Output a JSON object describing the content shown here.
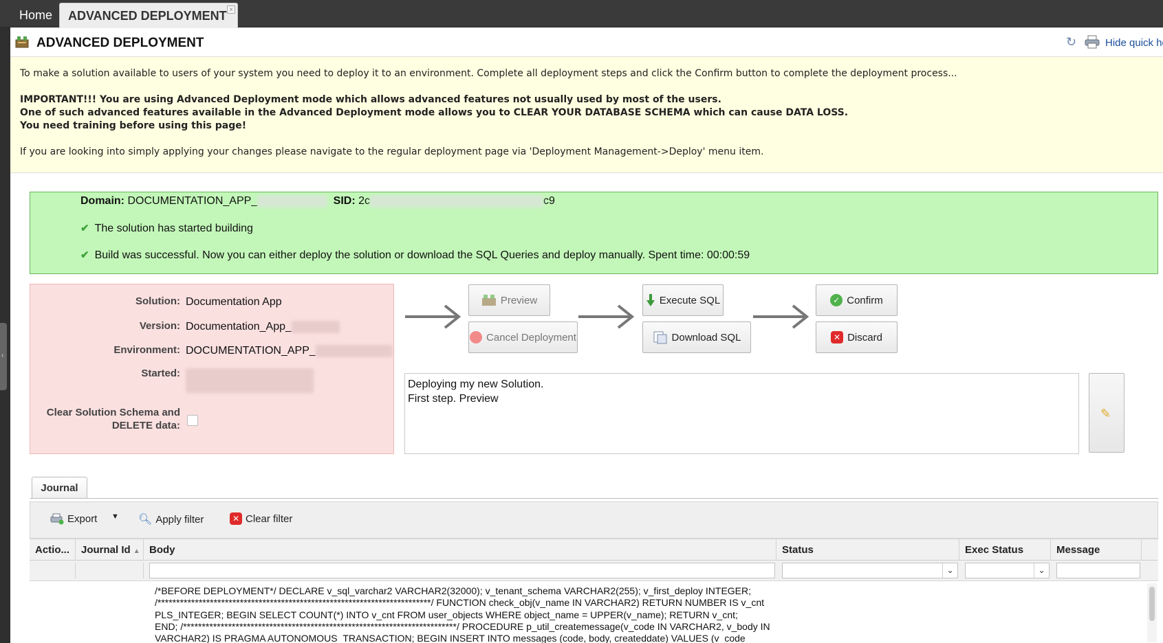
{
  "tabs": {
    "home": "Home",
    "active": "ADVANCED DEPLOYMENT",
    "close_glyph": "×"
  },
  "header": {
    "title": "ADVANCED DEPLOYMENT",
    "hide_help": "Hide quick he"
  },
  "help": {
    "line1": "To make a solution available to users of your system you need to deploy it to an environment. Complete all deployment steps and click the Confirm button to complete the deployment process...",
    "important1": "IMPORTANT!!! You are using Advanced Deployment mode which allows advanced features not usually used by most of the users.",
    "important2": "One of such advanced features available in the Advanced Deployment mode allows you to CLEAR YOUR DATABASE SCHEMA which can cause DATA LOSS.",
    "important3": "You need training before using this page!",
    "line_regular": "If you are looking into simply applying your changes please navigate to the regular deployment page via 'Deployment Management->Deploy' menu item."
  },
  "status": {
    "domain_label": "Domain:",
    "domain_value": "DOCUMENTATION_APP_",
    "sid_label": "SID:",
    "sid_prefix": "2c",
    "sid_suffix": "c9",
    "msg1": "The solution has started building",
    "msg2": "Build was successful. Now you can either deploy the solution or download the SQL Queries and deploy manually. Spent time: 00:00:59"
  },
  "solution": {
    "solution_label": "Solution:",
    "solution_value": "Documentation App",
    "version_label": "Version:",
    "version_value": "Documentation_App_",
    "environment_label": "Environment:",
    "environment_value": "DOCUMENTATION_APP_",
    "started_label": "Started:",
    "clear_label_1": "Clear Solution Schema and",
    "clear_label_2": "DELETE data:"
  },
  "actions": {
    "preview": "Preview",
    "cancel": "Cancel Deployment",
    "execute": "Execute SQL",
    "download": "Download SQL",
    "confirm": "Confirm",
    "discard": "Discard"
  },
  "notes": {
    "line1": "Deploying my new Solution.",
    "line2": "First step. Preview"
  },
  "journal": {
    "tab": "Journal",
    "toolbar": {
      "export": "Export",
      "apply_filter": "Apply filter",
      "clear_filter": "Clear filter"
    },
    "columns": {
      "actions": "Actio...",
      "journal_id": "Journal Id",
      "body": "Body",
      "status": "Status",
      "exec_status": "Exec Status",
      "message": "Message"
    },
    "row_body": "/*BEFORE DEPLOYMENT*/ DECLARE v_sql_varchar2 VARCHAR2(32000); v_tenant_schema VARCHAR2(255); v_first_deploy INTEGER;\n/*************************************************************************/ FUNCTION check_obj(v_name IN VARCHAR2) RETURN NUMBER IS v_cnt\nPLS_INTEGER; BEGIN SELECT COUNT(*) INTO v_cnt FROM user_objects WHERE object_name = UPPER(v_name); RETURN v_cnt;\nEND; /*************************************************************************/ PROCEDURE p_util_createmessage(v_code IN VARCHAR2, v_body IN\nVARCHAR2) IS PRAGMA AUTONOMOUS_TRANSACTION; BEGIN INSERT INTO messages (code, body, createddate) VALUES (v_code"
  },
  "colors": {
    "help_bg": "#ffffe1",
    "success_bg": "#c3f7b9",
    "warning_bg": "#fbe0e0",
    "link": "#1a4e9c"
  }
}
